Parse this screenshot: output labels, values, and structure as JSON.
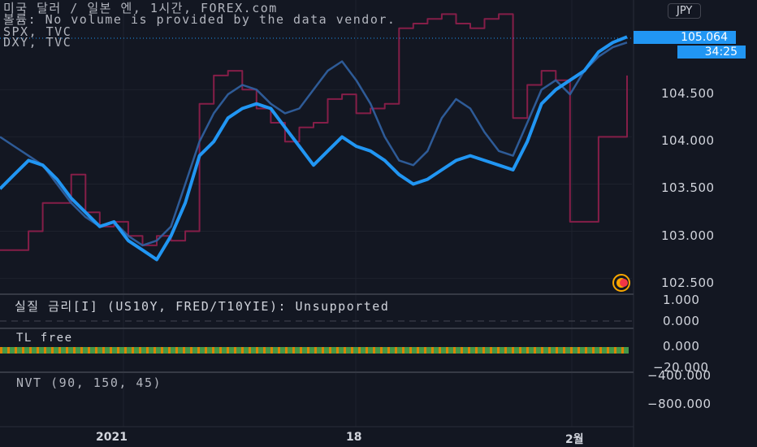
{
  "legend": {
    "title": "미국 달러 / 일본 엔, 1시간, FOREX.com",
    "volume_note": "볼륨: No volume is provided by the data vendor.",
    "series2": "SPX, TVC",
    "series3": "DXY, TVC"
  },
  "currency_badge": "JPY",
  "price_tag": {
    "price": "105.064",
    "countdown": "34:25"
  },
  "panes": {
    "real_rate": {
      "title": "실질 금리[I] (US10Y, FRED/T10YIE): Unsupported",
      "ticks": [
        "1.000",
        "0.000"
      ]
    },
    "tl": {
      "title": "TL free",
      "ticks": [
        "0.000",
        "−20.000"
      ]
    },
    "nvt": {
      "title": "NVT (90, 150, 45)",
      "ticks": [
        "−400.000",
        "−800.000"
      ]
    }
  },
  "colors": {
    "background": "#131722",
    "main_series": "#2196f3",
    "spx": "#2f5f9e",
    "dxy": "#8b1f4b",
    "grid": "#1e222d",
    "tl_green": "#4caf50",
    "tl_orange": "#ff9800"
  },
  "chart_data": {
    "type": "line",
    "x_ticks": [
      "2021",
      "18",
      "2월"
    ],
    "y_ticks": [
      "104.500",
      "104.000",
      "103.500",
      "103.000",
      "102.500"
    ],
    "ylim": [
      102.35,
      105.45
    ],
    "last_value": 105.064,
    "series": [
      {
        "name": "미국 달러 / 일본 엔",
        "values": [
          103.45,
          103.6,
          103.75,
          103.7,
          103.55,
          103.35,
          103.2,
          103.05,
          103.1,
          102.9,
          102.8,
          102.7,
          102.95,
          103.3,
          103.8,
          103.95,
          104.2,
          104.3,
          104.35,
          104.3,
          104.1,
          103.9,
          103.7,
          103.85,
          104.0,
          103.9,
          103.85,
          103.75,
          103.6,
          103.5,
          103.55,
          103.65,
          103.75,
          103.8,
          103.75,
          103.7,
          103.65,
          103.95,
          104.35,
          104.5,
          104.6,
          104.7,
          104.9,
          105.0,
          105.06
        ]
      },
      {
        "name": "SPX",
        "values": [
          104.0,
          103.9,
          103.8,
          103.7,
          103.5,
          103.3,
          103.15,
          103.05,
          103.1,
          102.95,
          102.85,
          102.9,
          103.05,
          103.5,
          103.95,
          104.25,
          104.45,
          104.55,
          104.5,
          104.35,
          104.25,
          104.3,
          104.5,
          104.7,
          104.8,
          104.6,
          104.35,
          104.0,
          103.75,
          103.7,
          103.85,
          104.2,
          104.4,
          104.3,
          104.05,
          103.85,
          103.8,
          104.15,
          104.5,
          104.6,
          104.45,
          104.7,
          104.85,
          104.95,
          105.0
        ]
      },
      {
        "name": "DXY",
        "values": [
          102.8,
          102.8,
          103.0,
          103.3,
          103.3,
          103.6,
          103.2,
          103.05,
          103.1,
          102.95,
          102.85,
          102.95,
          102.9,
          103.0,
          104.35,
          104.65,
          104.7,
          104.5,
          104.3,
          104.15,
          103.95,
          104.1,
          104.15,
          104.4,
          104.45,
          104.25,
          104.3,
          104.35,
          105.15,
          105.2,
          105.25,
          105.3,
          105.2,
          105.15,
          105.25,
          105.3,
          104.2,
          104.55,
          104.7,
          104.6,
          103.1,
          103.1,
          104.0,
          104.0,
          104.65
        ]
      }
    ]
  }
}
